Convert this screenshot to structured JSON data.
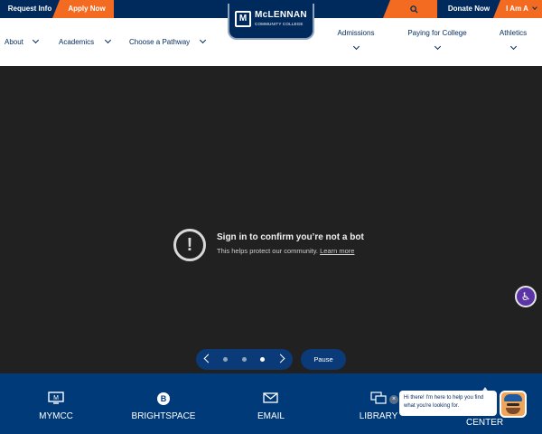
{
  "topbar": {
    "request_info": "Request Info",
    "apply_now": "Apply Now",
    "search_icon": "search-icon",
    "donate_now": "Donate Now",
    "i_am_a": "I Am A"
  },
  "logo": {
    "name": "McLENNAN",
    "subtitle": "COMMUNITY COLLEGE",
    "mark": "M"
  },
  "nav": {
    "about": "About",
    "academics": "Academics",
    "choose_pathway": "Choose a Pathway",
    "admissions": "Admissions",
    "paying_for_college": "Paying for College",
    "athletics": "Athletics"
  },
  "hero": {
    "title": "Sign in to confirm you’re not a bot",
    "subtitle": "This helps protect our community.",
    "learn_more": "Learn more",
    "pause": "Pause",
    "slide_count": 3,
    "active_slide": 3
  },
  "quick_links": [
    {
      "label": "MYMCC",
      "icon": "monitor-icon",
      "glyph": "🖥"
    },
    {
      "label": "BRIGHTSPACE",
      "icon": "brightspace-icon",
      "glyph": "◉"
    },
    {
      "label": "EMAIL",
      "icon": "envelope-icon",
      "glyph": "✉"
    },
    {
      "label": "LIBRARY",
      "icon": "library-icon",
      "glyph": "⧉"
    }
  ],
  "chat": {
    "message": "Hi there! I'm here to help you find what you're looking for.",
    "partial_label": "CENTER"
  },
  "colors": {
    "navy": "#002a5c",
    "orange": "#f26b21",
    "hero_bg": "#212121",
    "footer_blue": "#003a78",
    "accessibility_purple": "#5b34a5"
  }
}
